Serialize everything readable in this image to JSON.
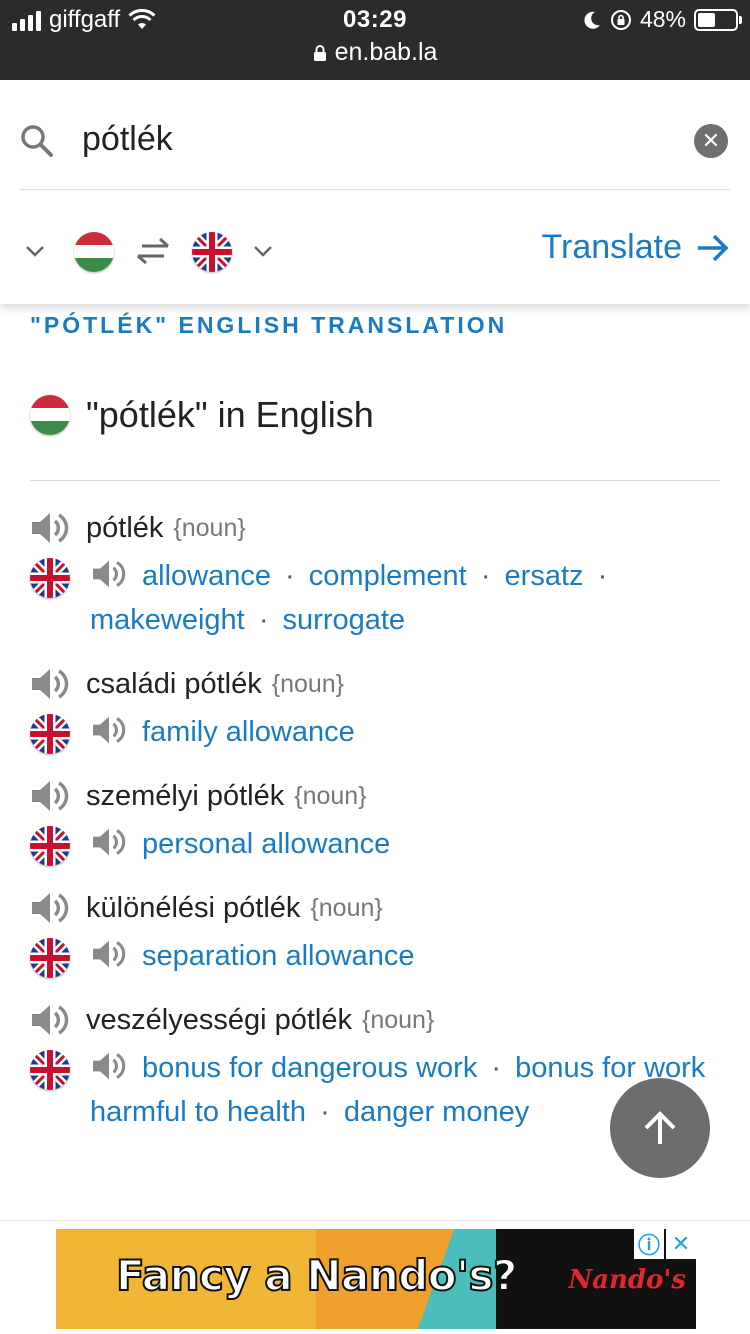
{
  "status_bar": {
    "carrier": "giffgaff",
    "time": "03:29",
    "url": "en.bab.la",
    "battery": "48%",
    "battery_level": 0.48
  },
  "search": {
    "value": "pótlék",
    "source_lang_flag": "hungary-flag",
    "target_lang_flag": "uk-flag",
    "translate_label": "Translate"
  },
  "section_title": "\"PÓTLÉK\" ENGLISH TRANSLATION",
  "lang_heading": "\"pótlék\" in English",
  "entries": [
    {
      "term": "pótlék",
      "pos": "{noun}",
      "translations": [
        "allowance",
        "complement",
        "ersatz",
        "makeweight",
        "surrogate"
      ]
    },
    {
      "term": "családi pótlék",
      "pos": "{noun}",
      "translations": [
        "family allowance"
      ]
    },
    {
      "term": "személyi pótlék",
      "pos": "{noun}",
      "translations": [
        "personal allowance"
      ]
    },
    {
      "term": "különélési pótlék",
      "pos": "{noun}",
      "translations": [
        "separation allowance"
      ]
    },
    {
      "term": "veszélyességi pótlék",
      "pos": "{noun}",
      "translations": [
        "bonus for dangerous work",
        "bonus for work harmful to health",
        "danger money"
      ]
    }
  ],
  "ad": {
    "headline": "Fancy a Nando's?",
    "brand": "Nando's",
    "info_icon": "ⓘ",
    "close_icon": "✕"
  },
  "colors": {
    "accent": "#1a7bc5",
    "status_bar": "#2b2b2b",
    "scroll_button": "#6d6d6d"
  }
}
